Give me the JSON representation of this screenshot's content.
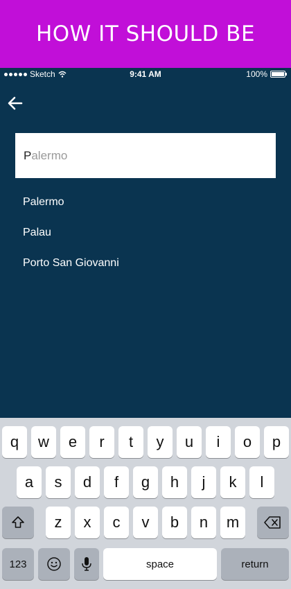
{
  "banner": {
    "title": "HOW IT SHOULD BE"
  },
  "status_bar": {
    "carrier": "Sketch",
    "time": "9:41 AM",
    "battery": "100%"
  },
  "search": {
    "typed": "P",
    "autocomplete": "alermo"
  },
  "suggestions": [
    "Palermo",
    "Palau",
    "Porto San Giovanni"
  ],
  "keyboard": {
    "row1": [
      "q",
      "w",
      "e",
      "r",
      "t",
      "y",
      "u",
      "i",
      "o",
      "p"
    ],
    "row2": [
      "a",
      "s",
      "d",
      "f",
      "g",
      "h",
      "j",
      "k",
      "l"
    ],
    "row3": [
      "z",
      "x",
      "c",
      "v",
      "b",
      "n",
      "m"
    ],
    "numbers_label": "123",
    "space_label": "space",
    "return_label": "return"
  },
  "colors": {
    "banner": "#c10fd8",
    "screen": "#0a3450",
    "keyboard": "#d1d5db"
  },
  "icons": [
    "back-arrow-icon",
    "wifi-icon",
    "battery-icon",
    "shift-icon",
    "backspace-icon",
    "emoji-icon",
    "microphone-icon"
  ]
}
